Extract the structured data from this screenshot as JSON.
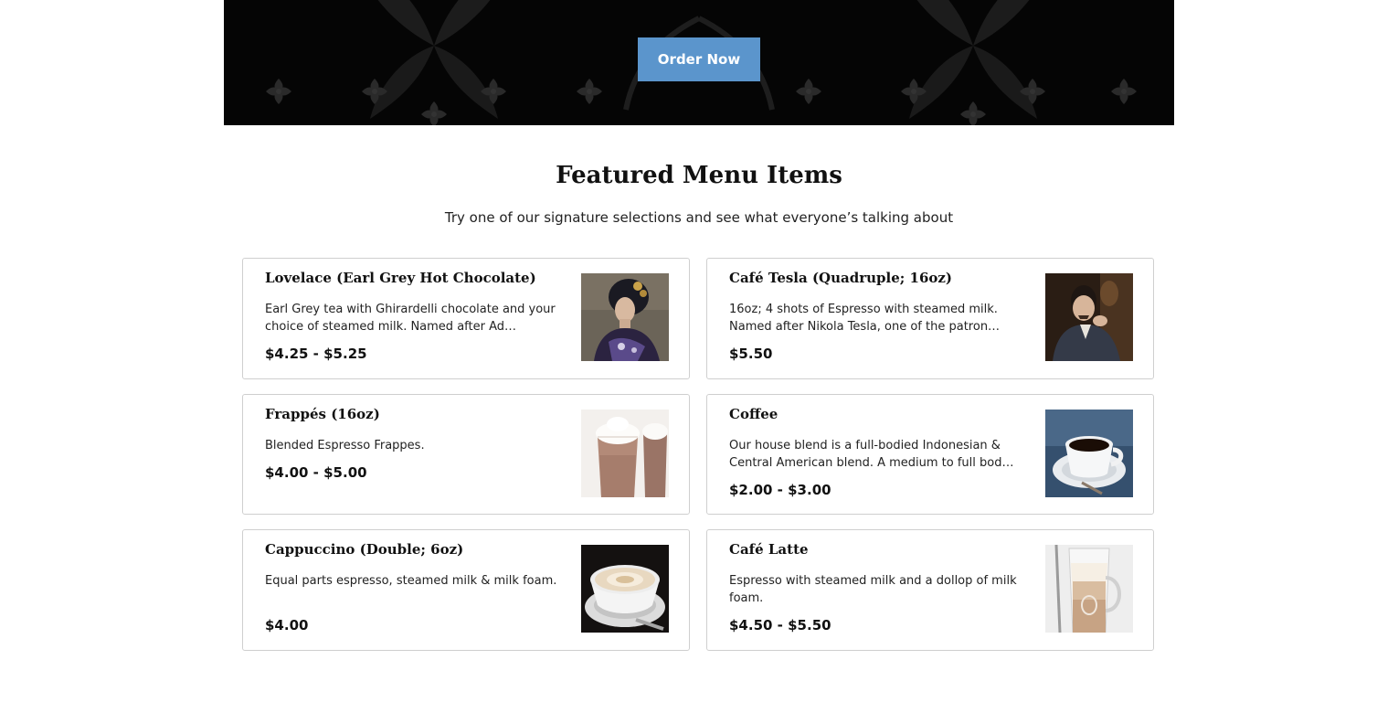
{
  "hero": {
    "order_button": "Order Now"
  },
  "featured": {
    "title": "Featured Menu Items",
    "subtitle": "Try one of our signature selections and see what everyone’s talking about"
  },
  "menu_items": [
    {
      "name": "Lovelace (Earl Grey Hot Chocolate)",
      "description": "Earl Grey tea with Ghirardelli chocolate and your choice of steamed milk. Named after Ad…",
      "price": "$4.25 - $5.25",
      "image": "ada-lovelace-portrait"
    },
    {
      "name": "Café Tesla (Quadruple; 16oz)",
      "description": "16oz; 4 shots of Espresso with steamed milk. Named after Nikola Tesla, one of the patron…",
      "price": "$5.50",
      "image": "nikola-tesla-portrait"
    },
    {
      "name": "Frappés (16oz)",
      "description": "Blended Espresso Frappes.",
      "price": "$4.00 - $5.00",
      "image": "frappe-glasses"
    },
    {
      "name": "Coffee",
      "description": "Our house blend is a full-bodied Indonesian & Central American blend. A medium to full bod…",
      "price": "$2.00 - $3.00",
      "image": "coffee-cup"
    },
    {
      "name": "Cappuccino (Double; 6oz)",
      "description": "Equal parts espresso, steamed milk & milk foam.",
      "price": "$4.00",
      "image": "cappuccino-cup"
    },
    {
      "name": "Café Latte",
      "description": "Espresso with steamed milk and a dollop of milk foam.",
      "price": "$4.50 - $5.50",
      "image": "latte-glass"
    }
  ],
  "colors": {
    "accent": "#5b95cc",
    "hero_background": "#050505",
    "card_border": "#cfcfcf"
  }
}
